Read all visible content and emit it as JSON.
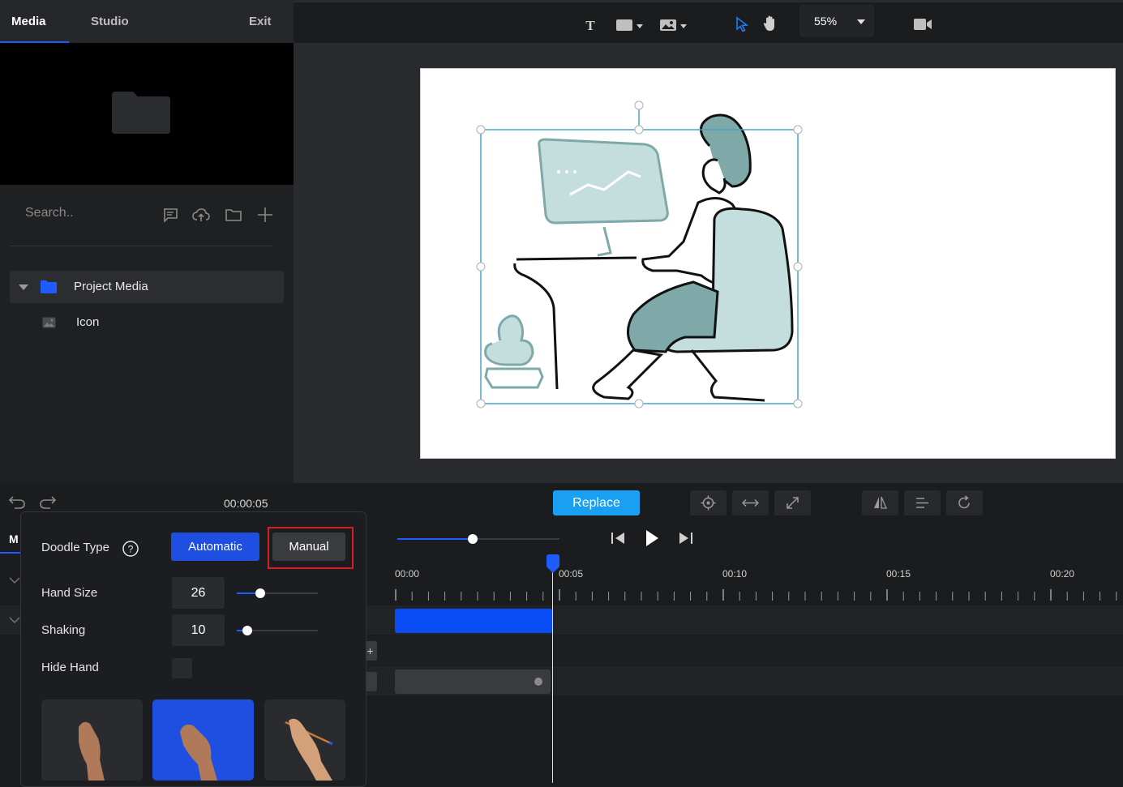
{
  "left_panel": {
    "tabs": [
      {
        "label": "Media"
      },
      {
        "label": "Studio"
      },
      {
        "label": "Exit"
      }
    ],
    "search_placeholder": "Search..",
    "tree": {
      "folder_label": "Project Media",
      "items": [
        {
          "label": "Icon"
        }
      ]
    }
  },
  "toolbar": {
    "zoom": "55%"
  },
  "timeline": {
    "current_time": "00:00:05",
    "replace_label": "Replace",
    "ruler": [
      "00:00",
      "00:05",
      "00:10",
      "00:15",
      "00:20"
    ],
    "partial_tab_label": "M"
  },
  "doodle_popup": {
    "doodle_type_label": "Doodle Type",
    "automatic_label": "Automatic",
    "manual_label": "Manual",
    "hand_size_label": "Hand Size",
    "hand_size_value": "26",
    "shaking_label": "Shaking",
    "shaking_value": "10",
    "hide_hand_label": "Hide Hand",
    "hand_size_level": 0.26,
    "shaking_level": 0.1,
    "selected_hand_index": 1
  },
  "colors": {
    "accent_blue": "#1f4fe0",
    "replace_blue": "#1aa0f2",
    "highlight_red": "#d62020",
    "teal_illustration": "#7fa9a8"
  },
  "icons": [
    "text-icon",
    "shape-icon",
    "image-icon",
    "pointer-icon",
    "hand-icon",
    "camera-icon",
    "undo-icon",
    "redo-icon",
    "play-icon"
  ]
}
